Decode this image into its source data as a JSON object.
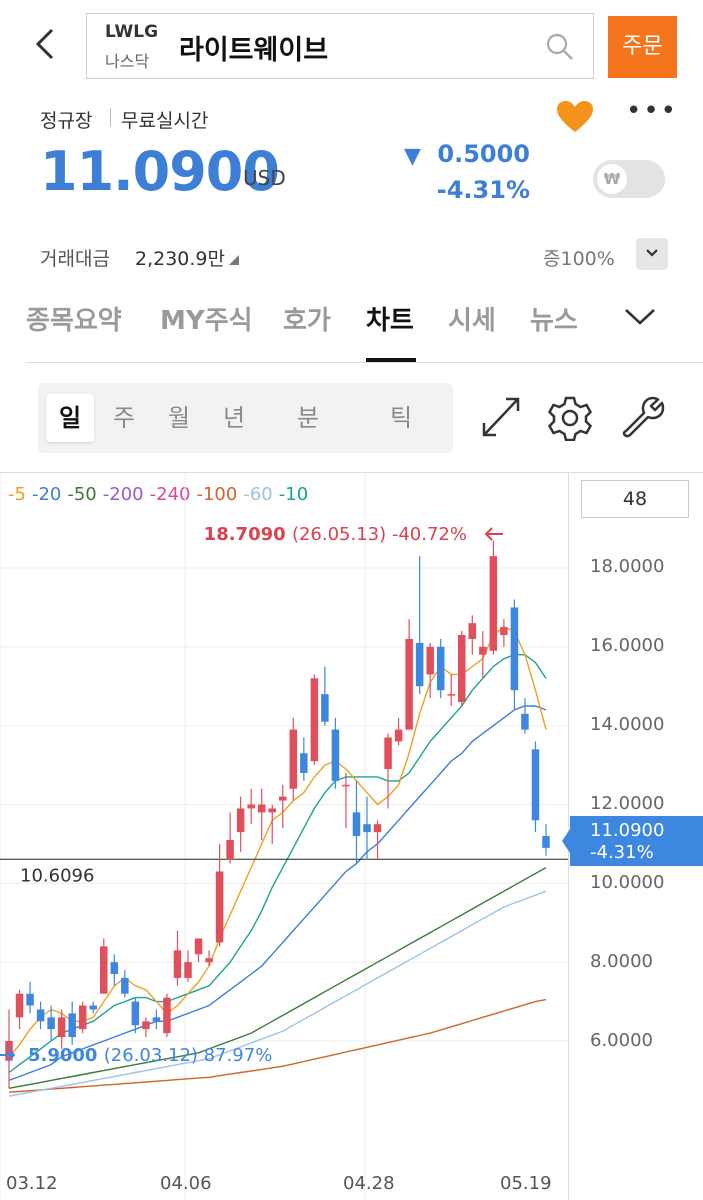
{
  "header": {
    "back_icon": "chevron-left-icon",
    "ticker": "LWLG",
    "market": "나스닥",
    "stock_name": "라이트웨이브",
    "search_icon": "search-icon",
    "order_label": "주문"
  },
  "info": {
    "session": "정규장",
    "realtime": "무료실시간",
    "price": "11.0900",
    "currency": "USD",
    "change": "0.5000",
    "change_pct": "-4.31%",
    "direction": "down",
    "volume_label": "거래대금",
    "volume_value": "2,230.9만",
    "zoom_label": "증100%",
    "toggle_symbol": "₩",
    "favorite": true,
    "accent_color": "#3d7fd6",
    "order_color": "#f4751c"
  },
  "tabs": [
    {
      "label": "종목요약",
      "active": false
    },
    {
      "label": "MY주식",
      "active": false
    },
    {
      "label": "호가",
      "active": false
    },
    {
      "label": "차트",
      "active": true
    },
    {
      "label": "시세",
      "active": false
    },
    {
      "label": "뉴스",
      "active": false
    }
  ],
  "periods": [
    {
      "label": "일",
      "selected": true
    },
    {
      "label": "주",
      "selected": false
    },
    {
      "label": "월",
      "selected": false
    },
    {
      "label": "년",
      "selected": false
    },
    {
      "label": "분",
      "selected": false
    },
    {
      "label": "틱",
      "selected": false
    }
  ],
  "chart_controls": {
    "count_value": "48"
  },
  "chart_data": {
    "type": "candlestick",
    "ma_legend": [
      {
        "label": "5",
        "color": "#f0a020"
      },
      {
        "label": "20",
        "color": "#3b7fd8"
      },
      {
        "label": "50",
        "color": "#3d7a3a"
      },
      {
        "label": "200",
        "color": "#9b59d0"
      },
      {
        "label": "240",
        "color": "#e0449a"
      },
      {
        "label": "100",
        "color": "#d2642a"
      },
      {
        "label": "60",
        "color": "#9cc3ea"
      },
      {
        "label": "10",
        "color": "#1aa392"
      }
    ],
    "y_ticks": [
      "18.0000",
      "16.0000",
      "14.0000",
      "12.0000",
      "10.0000",
      "8.0000",
      "6.0000"
    ],
    "ylim": [
      4.3,
      19.8
    ],
    "x_ticks": [
      "03.12",
      "04.06",
      "04.28",
      "05.19"
    ],
    "high_annotation": {
      "value": "18.7090",
      "date": "(26.05.13)",
      "pct": "-40.72%"
    },
    "low_annotation": {
      "value": "5.9000",
      "date": "(26.03.12)",
      "pct": "87.97%"
    },
    "reference_line": "10.6096",
    "current_price": "11.0900",
    "current_pct": "-4.31%",
    "candles": [
      [
        5.5,
        6.8,
        4.8,
        6.0
      ],
      [
        6.6,
        7.3,
        6.3,
        7.2
      ],
      [
        7.2,
        7.5,
        6.7,
        6.9
      ],
      [
        6.8,
        7.0,
        6.3,
        6.5
      ],
      [
        6.6,
        6.9,
        6.0,
        6.3
      ],
      [
        6.1,
        6.8,
        5.8,
        6.6
      ],
      [
        6.7,
        7.0,
        5.9,
        6.1
      ],
      [
        6.3,
        7.0,
        6.2,
        6.9
      ],
      [
        6.9,
        7.0,
        6.7,
        6.8
      ],
      [
        7.2,
        8.6,
        7.2,
        8.4
      ],
      [
        8.0,
        8.2,
        7.4,
        7.7
      ],
      [
        7.6,
        7.8,
        7.1,
        7.2
      ],
      [
        7.0,
        7.1,
        6.2,
        6.4
      ],
      [
        6.3,
        6.6,
        6.1,
        6.5
      ],
      [
        6.6,
        6.8,
        6.3,
        6.5
      ],
      [
        6.2,
        7.2,
        6.1,
        7.1
      ],
      [
        7.6,
        8.8,
        7.4,
        8.3
      ],
      [
        7.6,
        8.3,
        7.5,
        8.0
      ],
      [
        8.2,
        8.6,
        8.0,
        8.6
      ],
      [
        8.0,
        8.3,
        7.9,
        8.1
      ],
      [
        8.5,
        11.0,
        8.4,
        10.3
      ],
      [
        10.6,
        11.8,
        10.5,
        11.1
      ],
      [
        11.3,
        12.2,
        10.8,
        11.9
      ],
      [
        11.9,
        12.4,
        11.5,
        12.0
      ],
      [
        11.8,
        12.4,
        11.1,
        12.0
      ],
      [
        11.8,
        12.0,
        11.0,
        11.9
      ],
      [
        12.1,
        12.5,
        11.4,
        12.2
      ],
      [
        12.4,
        14.2,
        12.1,
        13.9
      ],
      [
        13.3,
        13.7,
        12.6,
        12.8
      ],
      [
        13.1,
        15.3,
        13.0,
        15.2
      ],
      [
        14.8,
        15.5,
        14.0,
        14.1
      ],
      [
        13.9,
        14.2,
        12.4,
        12.6
      ],
      [
        12.5,
        12.8,
        11.4,
        12.5
      ],
      [
        11.8,
        12.6,
        10.5,
        11.2
      ],
      [
        11.5,
        12.2,
        10.6,
        11.3
      ],
      [
        11.3,
        11.6,
        10.6,
        11.5
      ],
      [
        12.9,
        13.8,
        11.9,
        13.7
      ],
      [
        13.6,
        14.2,
        13.5,
        13.9
      ],
      [
        13.9,
        16.7,
        13.9,
        16.2
      ],
      [
        16.1,
        18.3,
        14.8,
        15.0
      ],
      [
        15.3,
        16.1,
        14.7,
        16.0
      ],
      [
        16.0,
        16.2,
        14.7,
        14.9
      ],
      [
        14.8,
        15.3,
        14.5,
        14.8
      ],
      [
        14.6,
        16.4,
        14.5,
        16.3
      ],
      [
        16.2,
        16.8,
        15.8,
        16.6
      ],
      [
        15.8,
        16.4,
        15.2,
        16.0
      ],
      [
        15.9,
        18.7,
        15.8,
        18.3
      ],
      [
        16.3,
        16.7,
        16.0,
        16.5
      ],
      [
        17.0,
        17.2,
        14.4,
        14.9
      ],
      [
        14.3,
        14.7,
        13.8,
        13.9
      ],
      [
        13.4,
        13.6,
        11.3,
        11.6
      ],
      [
        11.2,
        11.5,
        10.7,
        10.9
      ]
    ],
    "ma_5": [
      5.6,
      5.9,
      6.3,
      6.6,
      6.8,
      6.7,
      6.5,
      6.5,
      6.6,
      7.0,
      7.4,
      7.6,
      7.4,
      7.3,
      7.0,
      6.7,
      6.9,
      7.2,
      7.5,
      7.9,
      8.6,
      9.2,
      9.8,
      10.4,
      11.0,
      11.6,
      11.8,
      12.1,
      12.3,
      12.7,
      13.0,
      13.1,
      12.9,
      12.6,
      12.3,
      12.0,
      12.2,
      12.5,
      13.3,
      14.3,
      15.1,
      15.5,
      15.3,
      15.3,
      15.5,
      15.7,
      16.3,
      16.5,
      16.4,
      15.8,
      14.9,
      13.9
    ],
    "ma_10": [
      5.2,
      5.4,
      5.6,
      5.8,
      6.0,
      6.2,
      6.3,
      6.4,
      6.5,
      6.7,
      6.9,
      7.0,
      7.1,
      7.1,
      7.0,
      7.0,
      7.1,
      7.2,
      7.3,
      7.4,
      7.7,
      8.0,
      8.4,
      8.8,
      9.3,
      9.9,
      10.4,
      10.9,
      11.4,
      11.9,
      12.3,
      12.6,
      12.7,
      12.7,
      12.7,
      12.7,
      12.6,
      12.6,
      12.8,
      13.2,
      13.6,
      13.9,
      14.2,
      14.5,
      14.9,
      15.2,
      15.5,
      15.7,
      15.8,
      15.8,
      15.6,
      15.2
    ],
    "ma_20": [
      5.0,
      5.1,
      5.2,
      5.3,
      5.4,
      5.6,
      5.7,
      5.8,
      5.9,
      6.0,
      6.1,
      6.2,
      6.3,
      6.4,
      6.5,
      6.5,
      6.6,
      6.7,
      6.8,
      6.9,
      7.1,
      7.3,
      7.5,
      7.7,
      7.9,
      8.2,
      8.5,
      8.8,
      9.1,
      9.4,
      9.7,
      10.0,
      10.3,
      10.5,
      10.8,
      11.0,
      11.3,
      11.6,
      11.9,
      12.2,
      12.5,
      12.8,
      13.1,
      13.3,
      13.6,
      13.8,
      14.0,
      14.2,
      14.4,
      14.5,
      14.5,
      14.4
    ],
    "ma_50": [
      4.8,
      4.85,
      4.9,
      4.95,
      5.0,
      5.05,
      5.1,
      5.15,
      5.2,
      5.25,
      5.3,
      5.35,
      5.4,
      5.45,
      5.5,
      5.55,
      5.6,
      5.65,
      5.7,
      5.8,
      5.9,
      6.0,
      6.1,
      6.2,
      6.35,
      6.5,
      6.65,
      6.8,
      6.95,
      7.1,
      7.25,
      7.4,
      7.55,
      7.7,
      7.85,
      8.0,
      8.15,
      8.3,
      8.45,
      8.6,
      8.75,
      8.9,
      9.05,
      9.2,
      9.35,
      9.5,
      9.65,
      9.8,
      9.95,
      10.1,
      10.25,
      10.4
    ],
    "ma_60": [
      4.6,
      4.65,
      4.7,
      4.75,
      4.8,
      4.85,
      4.9,
      4.95,
      5.0,
      5.05,
      5.1,
      5.15,
      5.2,
      5.25,
      5.3,
      5.35,
      5.4,
      5.45,
      5.5,
      5.55,
      5.65,
      5.75,
      5.85,
      5.95,
      6.05,
      6.15,
      6.25,
      6.4,
      6.55,
      6.7,
      6.85,
      7.0,
      7.15,
      7.3,
      7.45,
      7.6,
      7.75,
      7.9,
      8.05,
      8.2,
      8.35,
      8.5,
      8.65,
      8.8,
      8.95,
      9.1,
      9.25,
      9.4,
      9.5,
      9.6,
      9.7,
      9.8
    ],
    "ma_100": [
      4.7,
      4.72,
      4.74,
      4.76,
      4.78,
      4.8,
      4.82,
      4.84,
      4.86,
      4.88,
      4.9,
      4.92,
      4.94,
      4.96,
      4.98,
      5.0,
      5.02,
      5.04,
      5.06,
      5.08,
      5.12,
      5.16,
      5.2,
      5.24,
      5.28,
      5.32,
      5.36,
      5.42,
      5.48,
      5.54,
      5.6,
      5.66,
      5.72,
      5.78,
      5.84,
      5.9,
      5.96,
      6.02,
      6.08,
      6.14,
      6.2,
      6.28,
      6.36,
      6.44,
      6.52,
      6.6,
      6.68,
      6.76,
      6.84,
      6.92,
      7.0,
      7.05
    ]
  },
  "tool_icons": [
    "expand-icon",
    "settings-icon",
    "wrench-icon"
  ]
}
